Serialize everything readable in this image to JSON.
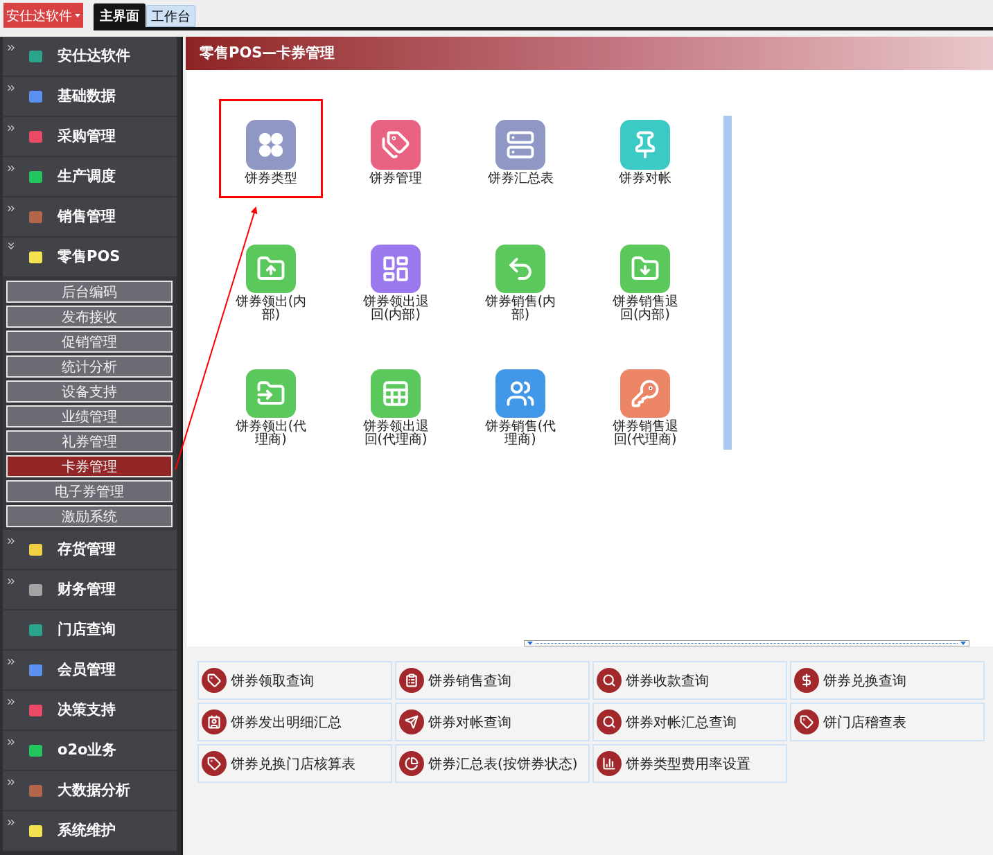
{
  "app_menu": {
    "label": "安仕达软件"
  },
  "tabs": [
    {
      "label": "主界面",
      "selected": true
    },
    {
      "label": "工作台",
      "selected": false
    }
  ],
  "sidebar": {
    "groups": [
      {
        "label": "安仕达软件",
        "color": "#2aa58c",
        "expandable": true,
        "expanded": false
      },
      {
        "label": "基础数据",
        "color": "#5b8ff0",
        "expandable": true,
        "expanded": false
      },
      {
        "label": "采购管理",
        "color": "#ea4a66",
        "expandable": true,
        "expanded": false
      },
      {
        "label": "生产调度",
        "color": "#22c55e",
        "expandable": true,
        "expanded": false
      },
      {
        "label": "销售管理",
        "color": "#b5654a",
        "expandable": true,
        "expanded": false
      },
      {
        "label": "零售POS",
        "color": "#f5e050",
        "expandable": true,
        "expanded": true,
        "children": [
          {
            "label": "后台编码",
            "selected": false
          },
          {
            "label": "发布接收",
            "selected": false
          },
          {
            "label": "促销管理",
            "selected": false
          },
          {
            "label": "统计分析",
            "selected": false
          },
          {
            "label": "设备支持",
            "selected": false
          },
          {
            "label": "业绩管理",
            "selected": false
          },
          {
            "label": "礼券管理",
            "selected": false
          },
          {
            "label": "卡券管理",
            "selected": true
          },
          {
            "label": "电子券管理",
            "selected": false
          },
          {
            "label": "激励系统",
            "selected": false
          }
        ]
      },
      {
        "label": "存货管理",
        "color": "#f0d040",
        "expandable": true,
        "expanded": false
      },
      {
        "label": "财务管理",
        "color": "#a3a3a3",
        "expandable": true,
        "expanded": false
      },
      {
        "label": "门店查询",
        "color": "#2aa58c",
        "expandable": false
      },
      {
        "label": "会员管理",
        "color": "#5b8ff0",
        "expandable": true,
        "expanded": false
      },
      {
        "label": "决策支持",
        "color": "#ea4a66",
        "expandable": true,
        "expanded": false
      },
      {
        "label": "o2o业务",
        "color": "#22c55e",
        "expandable": true,
        "expanded": false
      },
      {
        "label": "大数据分析",
        "color": "#b5654a",
        "expandable": true,
        "expanded": false
      },
      {
        "label": "系统维护",
        "color": "#f5e050",
        "expandable": true,
        "expanded": false
      }
    ]
  },
  "panel": {
    "title": "零售POS—卡券管理",
    "tiles": [
      {
        "label": "饼券类型",
        "kind": "grid",
        "color": "#8f98c4",
        "highlighted": true
      },
      {
        "label": "饼券管理",
        "kind": "tags",
        "color": "#ea6282",
        "highlighted": false
      },
      {
        "label": "饼券汇总表",
        "kind": "server",
        "color": "#8f98c4",
        "highlighted": false
      },
      {
        "label": "饼券对帐",
        "kind": "pin",
        "color": "#3ccac4",
        "highlighted": false
      },
      {
        "label": "饼券领出(内部)",
        "kind": "folder-up",
        "color": "#5ac85a",
        "highlighted": false
      },
      {
        "label": "饼券领出退回(内部)",
        "kind": "dashboard",
        "color": "#9a78ee",
        "highlighted": false
      },
      {
        "label": "饼券销售(内部)",
        "kind": "undo",
        "color": "#5ac85a",
        "highlighted": false
      },
      {
        "label": "饼券销售退回(内部)",
        "kind": "folder-down",
        "color": "#5ac85a",
        "highlighted": false
      },
      {
        "label": "饼券领出(代理商)",
        "kind": "folder-in",
        "color": "#5ac85a",
        "highlighted": false
      },
      {
        "label": "饼券领出退回(代理商)",
        "kind": "sheet",
        "color": "#5ac85a",
        "highlighted": false
      },
      {
        "label": "饼券销售(代理商)",
        "kind": "users",
        "color": "#4298e8",
        "highlighted": false
      },
      {
        "label": "饼券销售退回(代理商)",
        "kind": "key",
        "color": "#ec8466",
        "highlighted": false
      }
    ]
  },
  "links": [
    {
      "label": "饼券领取查询",
      "kind": "tag"
    },
    {
      "label": "饼券销售查询",
      "kind": "clipboard"
    },
    {
      "label": "饼券收款查询",
      "kind": "search"
    },
    {
      "label": "饼券兑换查询",
      "kind": "dollar"
    },
    {
      "label": "饼券发出明细汇总",
      "kind": "contact"
    },
    {
      "label": "饼券对帐查询",
      "kind": "send"
    },
    {
      "label": "饼券对帐汇总查询",
      "kind": "search"
    },
    {
      "label": "饼门店稽查表",
      "kind": "tag"
    },
    {
      "label": "饼券兑换门店核算表",
      "kind": "tag"
    },
    {
      "label": "饼券汇总表(按饼券状态)",
      "kind": "pie"
    },
    {
      "label": "饼券类型费用率设置",
      "kind": "bar"
    }
  ]
}
